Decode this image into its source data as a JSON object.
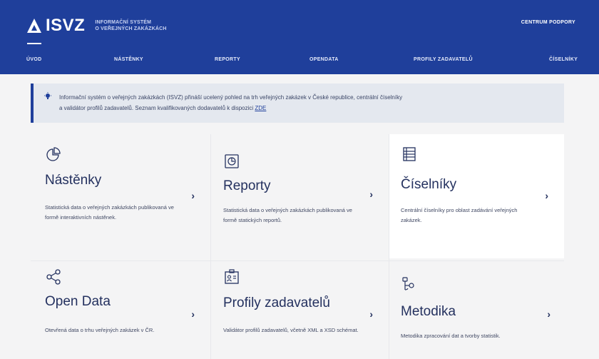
{
  "header": {
    "logo_text": "ISVZ",
    "logo_sub_line1": "INFORMAČNÍ SYSTÉM",
    "logo_sub_line2": "O VEŘEJNÝCH ZAKÁZKÁCH",
    "support_link": "CENTRUM PODPORY"
  },
  "nav": {
    "items": [
      {
        "label": "ÚVOD"
      },
      {
        "label": "NÁSTĚNKY"
      },
      {
        "label": "REPORTY"
      },
      {
        "label": "OPENDATA"
      },
      {
        "label": "PROFILY ZADAVATELŮ"
      },
      {
        "label": "ČÍSELNÍKY"
      }
    ]
  },
  "info": {
    "line1": "Informační systém o veřejných zakázkách (ISVZ) přináší ucelený pohled na trh veřejných zakázek v České republice, centrální číselníky",
    "line2": "a validátor profilů zadavatelů. Seznam kvalifikovaných dodavatelů k dispozici",
    "link": "ZDE"
  },
  "cards": [
    {
      "title": "Nástěnky",
      "desc": "Statistická data o veřejných zakázkách publikovaná ve formě interaktivních nástěnek.",
      "arrow": "›",
      "icon": "pie-chart-icon"
    },
    {
      "title": "Reporty",
      "desc": "Statistická data o veřejných zakázkách publikovaná ve formě statických reportů.",
      "arrow": "›",
      "icon": "report-icon"
    },
    {
      "title": "Číselníky",
      "desc": "Centrální číselníky pro oblast zadávání veřejných zakázek.",
      "arrow": "›",
      "icon": "list-icon"
    },
    {
      "title": "Open Data",
      "desc": "Otevřená data o trhu veřejných zakázek v ČR.",
      "arrow": "›",
      "icon": "share-icon"
    },
    {
      "title": "Profily zadavatelů",
      "desc": "Validátor profilů zadavatelů, včetně XML a XSD schémat.",
      "arrow": "›",
      "icon": "profile-card-icon"
    },
    {
      "title": "Metodika",
      "desc": "Metodika zpracování dat a tvorby statistik.",
      "arrow": "›",
      "icon": "methodology-icon"
    }
  ]
}
